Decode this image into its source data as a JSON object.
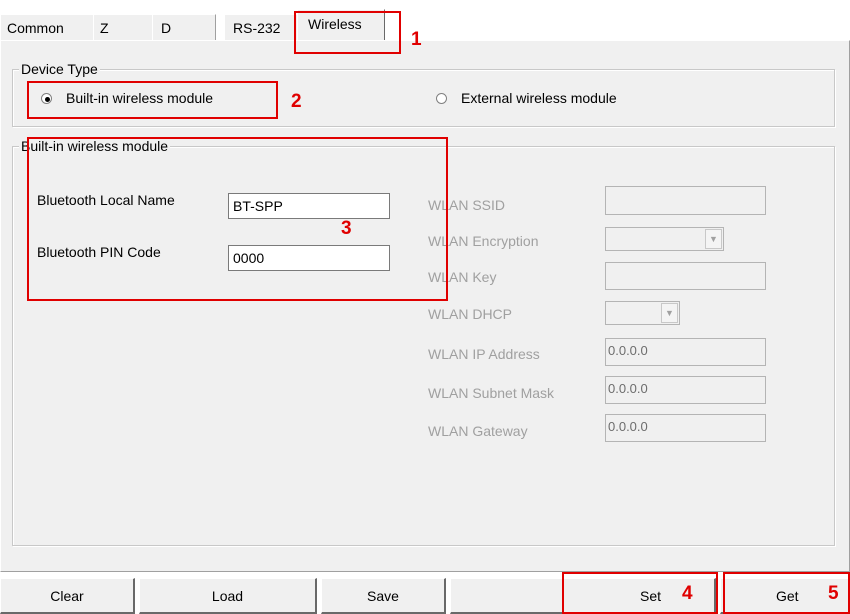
{
  "tabs": [
    "Common",
    "Z",
    "D",
    "RS-232",
    "Wireless"
  ],
  "active_tab": "Wireless",
  "device_type": {
    "legend": "Device Type",
    "builtin_label": "Built-in wireless module",
    "external_label": "External wireless module",
    "selected": "Built-in wireless module"
  },
  "builtin_group": {
    "legend": "Built-in wireless module",
    "bt_name_label": "Bluetooth Local Name",
    "bt_name_value": "BT-SPP",
    "bt_pin_label": "Bluetooth PIN Code",
    "bt_pin_value": "0000"
  },
  "wlan": {
    "ssid_label": "WLAN SSID",
    "ssid_value": "",
    "encryption_label": "WLAN Encryption",
    "key_label": "WLAN Key",
    "key_value": "",
    "dhcp_label": "WLAN DHCP",
    "ip_label": "WLAN IP Address",
    "ip_value": "0.0.0.0",
    "subnet_label": "WLAN Subnet Mask",
    "subnet_value": "0.0.0.0",
    "gateway_label": "WLAN Gateway",
    "gateway_value": "0.0.0.0"
  },
  "buttons": {
    "clear": "Clear",
    "load": "Load",
    "save": "Save",
    "set": "Set",
    "get": "Get"
  },
  "callouts": [
    "1",
    "2",
    "3",
    "4",
    "5"
  ],
  "colors": {
    "callout_red": "#e00000",
    "panel_bg": "#f0f0f0",
    "disabled_text": "#a0a0a0"
  },
  "icons": {
    "radio_selected": "radio-selected-icon",
    "radio_unselected": "radio-unselected-icon",
    "combo_arrow": "chevron-down-icon"
  }
}
